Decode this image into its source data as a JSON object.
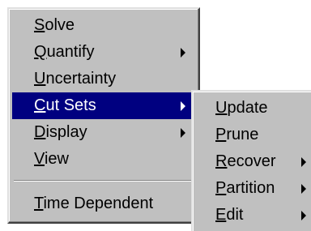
{
  "main_menu": {
    "items": [
      {
        "mnemonic": "S",
        "rest": "olve"
      },
      {
        "mnemonic": "Q",
        "rest": "uantify"
      },
      {
        "mnemonic": "U",
        "rest": "ncertainty"
      },
      {
        "mnemonic": "C",
        "rest": "ut Sets"
      },
      {
        "mnemonic": "D",
        "rest": "isplay"
      },
      {
        "mnemonic": "V",
        "rest": "iew"
      },
      {
        "mnemonic": "T",
        "rest": "ime Dependent"
      }
    ]
  },
  "cutsets_submenu": {
    "items": [
      {
        "mnemonic": "U",
        "rest": "pdate"
      },
      {
        "mnemonic": "P",
        "rest": "rune"
      },
      {
        "mnemonic": "R",
        "rest": "ecover"
      },
      {
        "mnemonic": "P",
        "rest": "artition"
      },
      {
        "mnemonic": "E",
        "rest": "dit"
      }
    ]
  },
  "colors": {
    "menu_face": "#c0c0c0",
    "highlight": "#000080",
    "highlight_text": "#ffffff"
  }
}
